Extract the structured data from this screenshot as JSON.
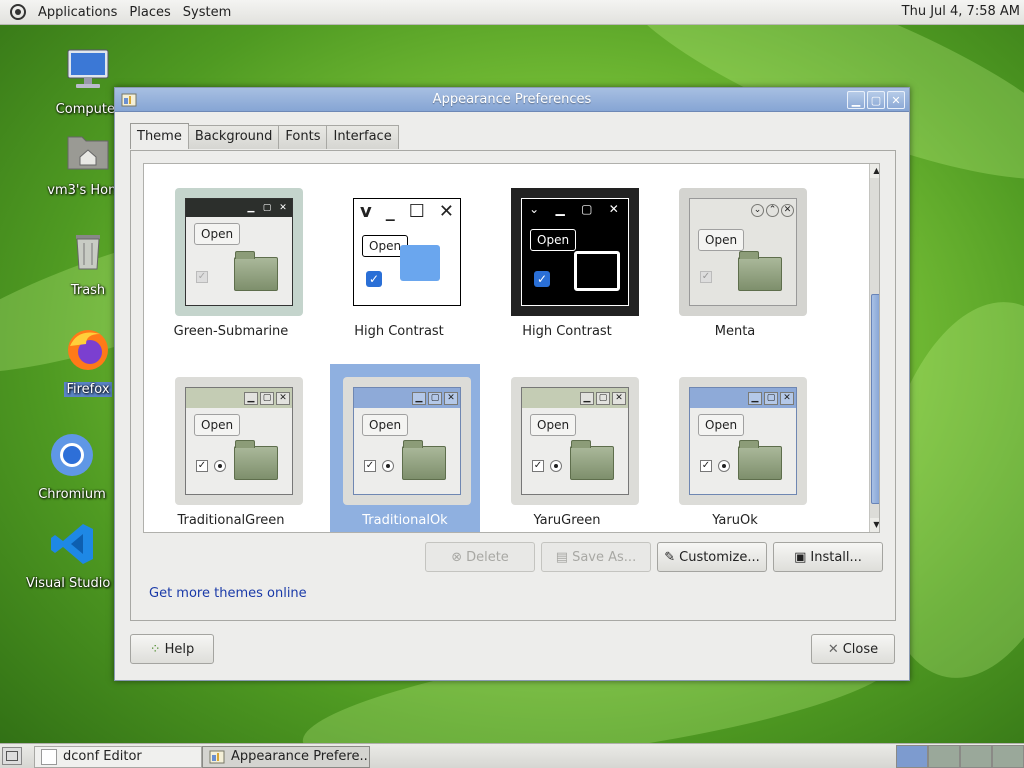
{
  "top_panel": {
    "menus": [
      "Applications",
      "Places",
      "System"
    ],
    "clock": "Thu Jul  4,  7:58 AM"
  },
  "desktop_icons": [
    {
      "label": "Computer",
      "icon": "computer-icon"
    },
    {
      "label": "vm3's Home",
      "icon": "home-folder-icon"
    },
    {
      "label": "Trash",
      "icon": "trash-icon"
    },
    {
      "label": "Firefox",
      "icon": "firefox-icon"
    },
    {
      "label": "Chromium",
      "icon": "chromium-icon"
    },
    {
      "label": "Visual Studio Code",
      "icon": "vscode-icon"
    }
  ],
  "window": {
    "title": "Appearance Preferences",
    "tabs": [
      "Theme",
      "Background",
      "Fonts",
      "Interface"
    ],
    "active_tab": "Theme",
    "themes": [
      {
        "name": "Green-Submarine",
        "open_label": "Open"
      },
      {
        "name": "High Contrast",
        "open_label": "Open"
      },
      {
        "name": "High Contrast",
        "open_label": "Open"
      },
      {
        "name": "Menta",
        "open_label": "Open"
      },
      {
        "name": "TraditionalGreen",
        "open_label": "Open"
      },
      {
        "name": "TraditionalOk",
        "open_label": "Open"
      },
      {
        "name": "YaruGreen",
        "open_label": "Open"
      },
      {
        "name": "YaruOk",
        "open_label": "Open"
      }
    ],
    "selected_theme": "TraditionalOk",
    "buttons": {
      "delete": "Delete",
      "save_as": "Save As...",
      "customize": "Customize...",
      "install": "Install..."
    },
    "get_more_link": "Get more themes online",
    "help": "Help",
    "close": "Close"
  },
  "taskbar": {
    "tasks": [
      "dconf Editor",
      "Appearance Prefere..."
    ]
  },
  "colors": {
    "titlebar": "#86a5d4",
    "selection": "#8fb0e0",
    "link": "#1a3aa8"
  }
}
